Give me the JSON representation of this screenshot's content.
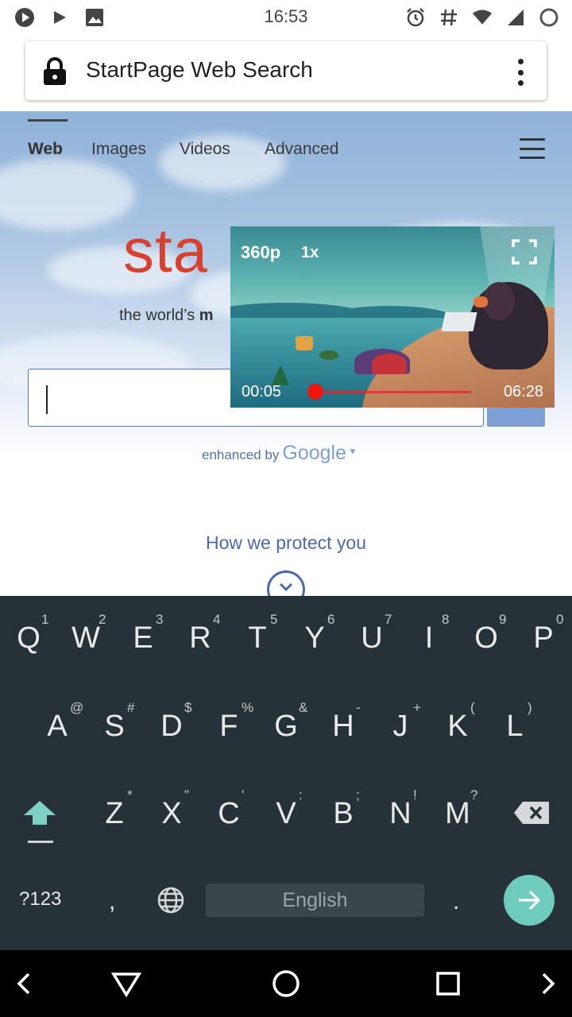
{
  "status_bar": {
    "time": "16:53",
    "left_icons": [
      "play-circle-icon",
      "play-icon",
      "image-icon"
    ],
    "right_icons": [
      "alarm-icon",
      "hash-icon",
      "wifi-icon",
      "signal-icon",
      "battery-icon"
    ]
  },
  "url_bar": {
    "title": "StartPage Web Search",
    "icons": [
      "lock-icon",
      "overflow-menu-icon"
    ]
  },
  "page": {
    "nav": {
      "tabs": [
        {
          "label": "Web",
          "active": true
        },
        {
          "label": "Images",
          "active": false
        },
        {
          "label": "Videos",
          "active": false
        },
        {
          "label": "Advanced",
          "active": false
        }
      ],
      "menu_icon": "hamburger-menu-icon"
    },
    "logo_text": "sta",
    "tagline_start": "the world’s ",
    "tagline_bold": "m",
    "search": {
      "value": ""
    },
    "enhanced_by": "enhanced by",
    "google_text": "Google",
    "google_caret": "▾",
    "protect_link": "How we protect you",
    "colors": {
      "logo": "#d8402f",
      "link": "#4b6aae",
      "search_button": "#7e9fd3"
    }
  },
  "video": {
    "quality": "360p",
    "speed": "1x",
    "current_time": "00:05",
    "total_time": "06:28",
    "progress_fraction": 0.013,
    "fullscreen_icon": "fullscreen-icon"
  },
  "keyboard": {
    "row1": [
      {
        "key": "Q",
        "hint": "1"
      },
      {
        "key": "W",
        "hint": "2"
      },
      {
        "key": "E",
        "hint": "3"
      },
      {
        "key": "R",
        "hint": "4"
      },
      {
        "key": "T",
        "hint": "5"
      },
      {
        "key": "Y",
        "hint": "6"
      },
      {
        "key": "U",
        "hint": "7"
      },
      {
        "key": "I",
        "hint": "8"
      },
      {
        "key": "O",
        "hint": "9"
      },
      {
        "key": "P",
        "hint": "0"
      }
    ],
    "row2": [
      {
        "key": "A",
        "hint": "@"
      },
      {
        "key": "S",
        "hint": "#"
      },
      {
        "key": "D",
        "hint": "$"
      },
      {
        "key": "F",
        "hint": "%"
      },
      {
        "key": "G",
        "hint": "&"
      },
      {
        "key": "H",
        "hint": "-"
      },
      {
        "key": "J",
        "hint": "+"
      },
      {
        "key": "K",
        "hint": "("
      },
      {
        "key": "L",
        "hint": ")"
      }
    ],
    "row3": [
      {
        "key": "Z",
        "hint": "*"
      },
      {
        "key": "X",
        "hint": "\""
      },
      {
        "key": "C",
        "hint": "'"
      },
      {
        "key": "V",
        "hint": ":"
      },
      {
        "key": "B",
        "hint": ";"
      },
      {
        "key": "N",
        "hint": "!"
      },
      {
        "key": "M",
        "hint": "?"
      }
    ],
    "symbols_key": "?123",
    "comma_key": ",",
    "space_label": "English",
    "period_key": ".",
    "icons": [
      "shift-icon",
      "backspace-icon",
      "globe-icon",
      "enter-arrow-icon"
    ],
    "colors": {
      "background": "#263238",
      "enter": "#6fcbbd"
    }
  },
  "nav_bar": {
    "icons": [
      "left-arrow-icon",
      "back-triangle-icon",
      "home-circle-icon",
      "recents-square-icon",
      "right-arrow-icon"
    ]
  }
}
